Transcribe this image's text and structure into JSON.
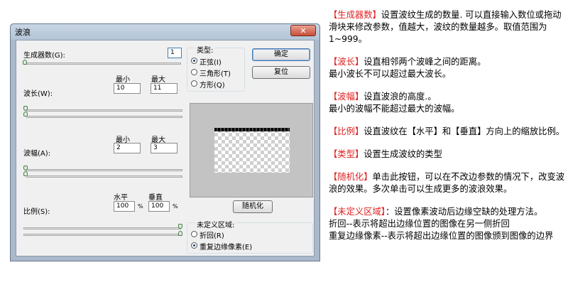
{
  "dialog": {
    "title": "波浪",
    "close_glyph": "✕",
    "generators_label": "生成器数(G):",
    "generators_value": "1",
    "wavelength_label": "波长(W):",
    "wavelength_min_label": "最小",
    "wavelength_max_label": "最大",
    "wavelength_min": "10",
    "wavelength_max": "11",
    "amplitude_label": "波幅(A):",
    "amplitude_min_label": "最小",
    "amplitude_max_label": "最大",
    "amplitude_min": "2",
    "amplitude_max": "3",
    "scale_label": "比例(S):",
    "scale_h_label": "水平",
    "scale_v_label": "垂直",
    "scale_h": "100",
    "scale_v": "100",
    "percent": "%",
    "type_group_label": "类型:",
    "type_options": [
      "正弦(I)",
      "三角形(T)",
      "方形(Q)"
    ],
    "type_selected": 0,
    "ok_label": "确定",
    "reset_label": "复位",
    "randomize_label": "随机化",
    "undefined_group_label": "未定义区域:",
    "undefined_options": [
      "折回(R)",
      "重复边缘像素(E)"
    ],
    "undefined_selected": 1
  },
  "explanation": {
    "generators": {
      "key": "【生成器数】",
      "text": "设置波纹生成的数量. 可以直接输入数位或拖动滑块来修改参数，值越大，波纹的数量越多。取值范围为1~999。"
    },
    "wavelength": {
      "key": "【波长】",
      "text": "设直相邻两个波峰之间的距离。",
      "line2": "最小波长不可以超过最大波长。"
    },
    "amplitude": {
      "key": "【波幅】",
      "text": "设直波浪的高度.。",
      "line2": "最小的波幅不能超过最大的波幅。"
    },
    "scale": {
      "key": "【比例】",
      "text": "设直波纹在【水平】和【垂直】方向上的缩放比例。"
    },
    "type": {
      "key": "【类型】",
      "text": "设置生成波纹的类型"
    },
    "randomize": {
      "key": "【随机化】",
      "text": "单击此按钮，可以在不改边参数的情况下，改变波浪的效果。多次单击可以生成更多的波浪效果。"
    },
    "undefined": {
      "key": "【未定义区域】",
      "text": "：设置像素波动后边缘空缺的处理方法。",
      "line2": "折回--表示将超出边缘位置的图像在另一侧折回",
      "line3": "重复边缘像素--表示将超出边缘位置的图像颁到图像的边界"
    }
  }
}
